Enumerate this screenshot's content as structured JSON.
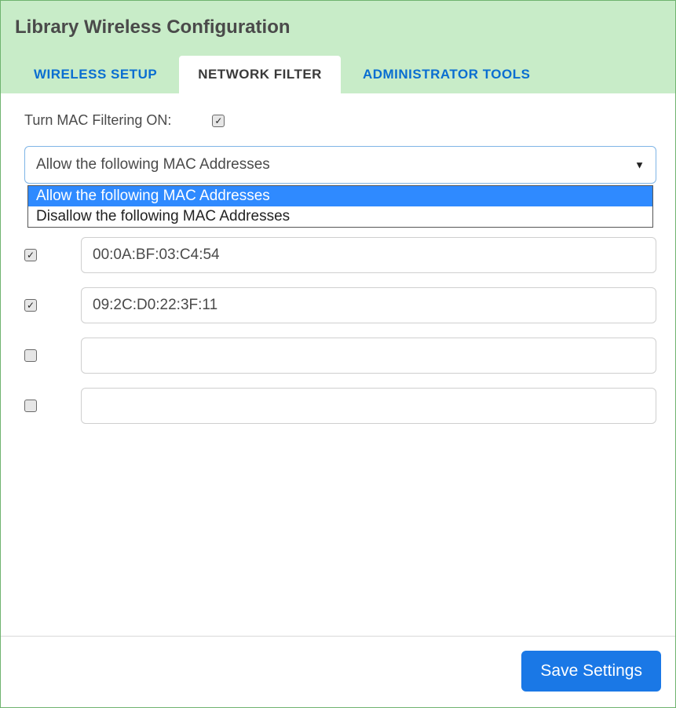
{
  "title": "Library Wireless Configuration",
  "tabs": [
    {
      "label": "WIRELESS SETUP",
      "active": false
    },
    {
      "label": "NETWORK FILTER",
      "active": true
    },
    {
      "label": "ADMINISTRATOR TOOLS",
      "active": false
    }
  ],
  "filter_toggle": {
    "label": "Turn MAC Filtering ON:",
    "checked": true
  },
  "mode_select": {
    "selected": "Allow the following MAC Addresses",
    "options": [
      {
        "label": "Allow the following MAC Addresses",
        "highlighted": true
      },
      {
        "label": "Disallow the following MAC Addresses",
        "highlighted": false
      }
    ]
  },
  "mac_rows": [
    {
      "checked": true,
      "value": "00:0A:BF:03:C4:54"
    },
    {
      "checked": true,
      "value": "09:2C:D0:22:3F:11"
    },
    {
      "checked": false,
      "value": ""
    },
    {
      "checked": false,
      "value": ""
    }
  ],
  "buttons": {
    "save": "Save Settings"
  }
}
